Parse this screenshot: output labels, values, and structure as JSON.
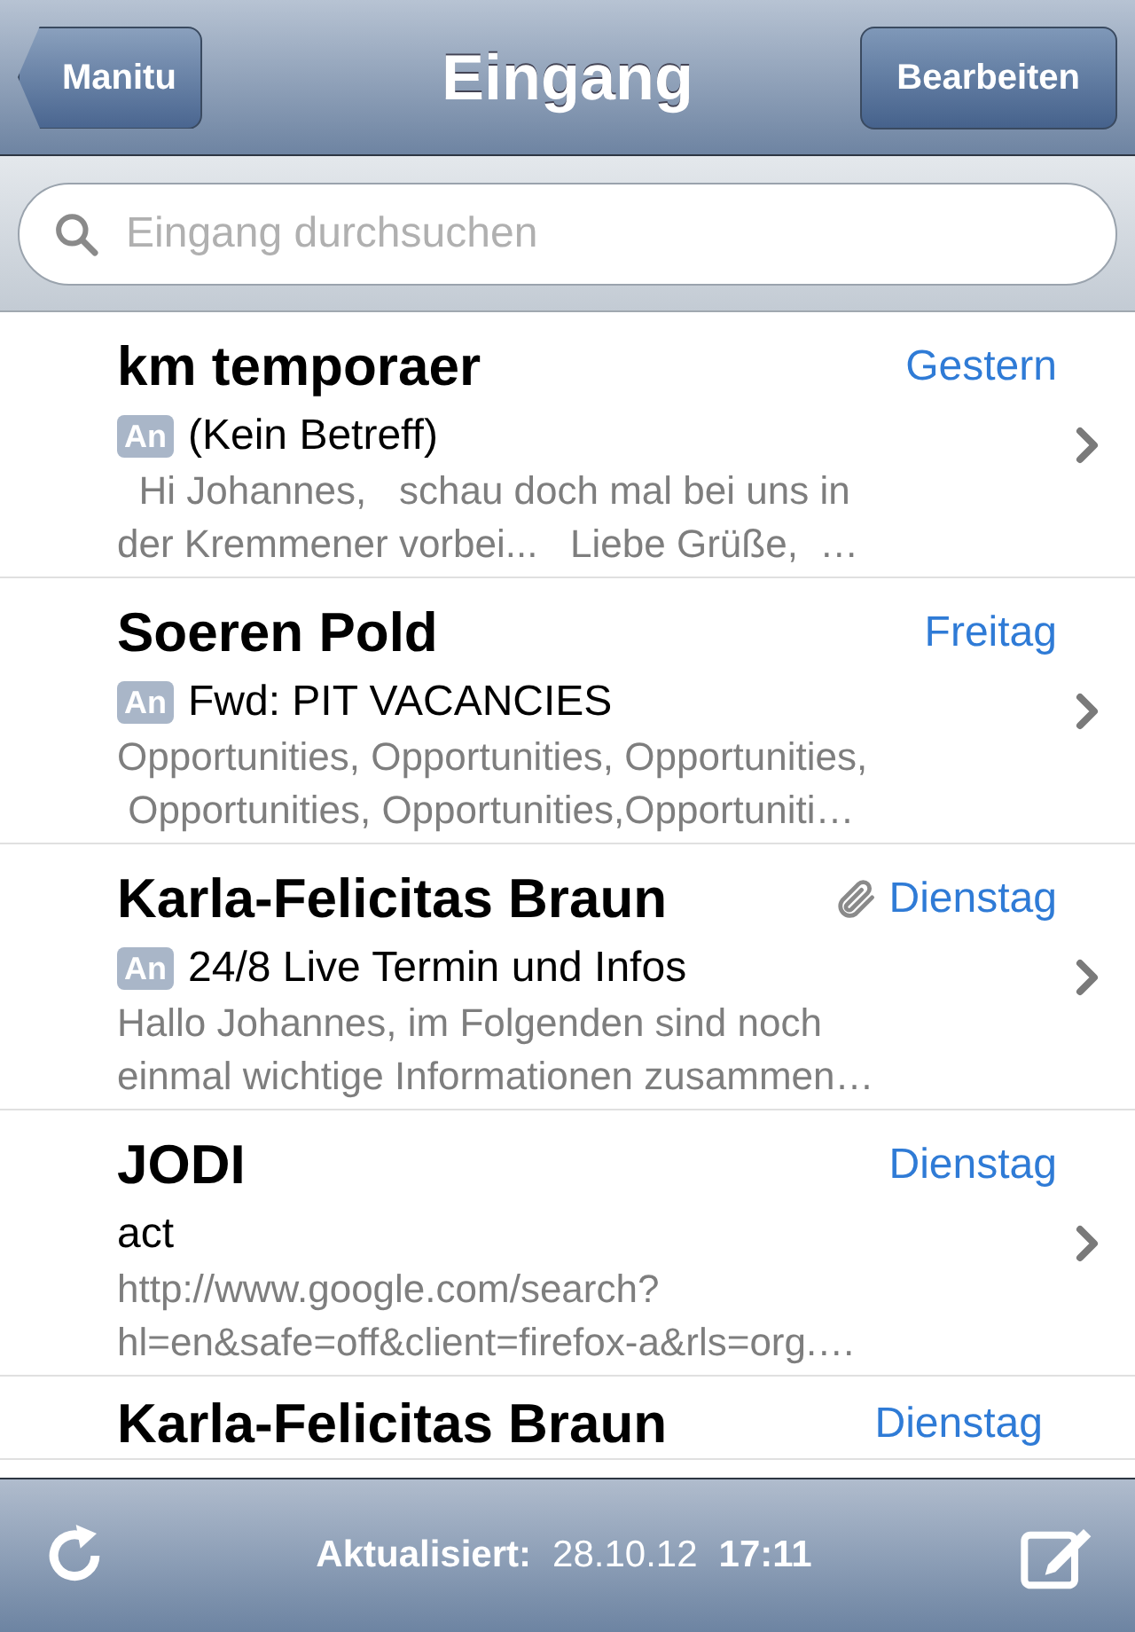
{
  "nav": {
    "back": "Manitu",
    "title": "Eingang",
    "action": "Bearbeiten"
  },
  "search": {
    "placeholder": "Eingang durchsuchen"
  },
  "messages": [
    {
      "sender": "km temporaer",
      "date": "Gestern",
      "attachment": false,
      "to_me": true,
      "tag": "An",
      "subject": "(Kein Betreff)",
      "preview": [
        "  Hi Johannes,   schau doch mal bei uns in",
        "der Kremmener vorbei...   Liebe Grüße,  …"
      ]
    },
    {
      "sender": "Soeren Pold",
      "date": "Freitag",
      "attachment": false,
      "to_me": true,
      "tag": "An",
      "subject": "Fwd: PIT VACANCIES",
      "preview": [
        "Opportunities, Opportunities, Opportunities,",
        " Opportunities, Opportunities,Opportuniti…"
      ]
    },
    {
      "sender": "Karla-Felicitas Braun",
      "date": "Dienstag",
      "attachment": true,
      "to_me": true,
      "tag": "An",
      "subject": "24/8 Live Termin und Infos",
      "preview": [
        "Hallo Johannes, im Folgenden sind noch",
        "einmal wichtige Informationen zusammen…"
      ]
    },
    {
      "sender": "JODI",
      "date": "Dienstag",
      "attachment": false,
      "to_me": false,
      "subject": "act",
      "preview": [
        "http://www.google.com/search?",
        "hl=en&safe=off&client=firefox-a&rls=org.…"
      ]
    },
    {
      "sender": "Karla-Felicitas Braun",
      "date": "Dienstag"
    }
  ],
  "toolbar": {
    "label": "Aktualisiert:",
    "date": "28.10.12",
    "time": "17:11"
  }
}
